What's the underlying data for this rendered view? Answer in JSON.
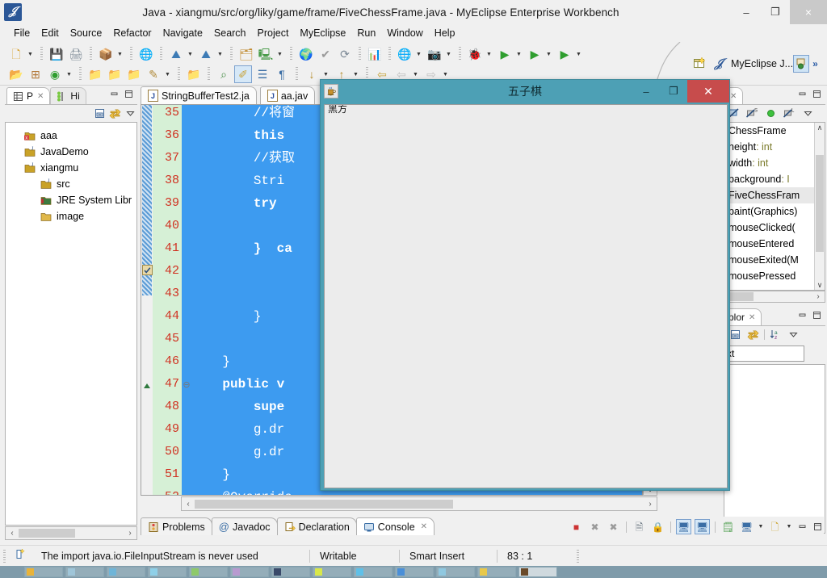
{
  "window": {
    "title": "Java - xiangmu/src/org/liky/game/frame/FiveChessFrame.java - MyEclipse Enterprise Workbench",
    "app_icon": "myeclipse-icon",
    "minimize": "–",
    "maximize": "❐",
    "close": "×"
  },
  "menubar": {
    "items": [
      {
        "label": "File"
      },
      {
        "label": "Edit"
      },
      {
        "label": "Source"
      },
      {
        "label": "Refactor"
      },
      {
        "label": "Navigate"
      },
      {
        "label": "Search"
      },
      {
        "label": "Project"
      },
      {
        "label": "MyEclipse"
      },
      {
        "label": "Run"
      },
      {
        "label": "Window"
      },
      {
        "label": "Help"
      }
    ]
  },
  "toolbar": {
    "row1": [
      {
        "name": "new-wizard-icon",
        "glyph": "🗋",
        "color": "#d7a12c",
        "arrow": true
      },
      {
        "name": "save-icon",
        "glyph": "💾",
        "color": "#9aa4ad",
        "arrow": false
      },
      {
        "name": "print-icon",
        "glyph": "🖨",
        "color": "#7d8a96",
        "arrow": false
      },
      {
        "name": "new-java-package-icon",
        "glyph": "📦",
        "color": "#b0782e",
        "arrow": true
      },
      {
        "name": "open-web-browser-icon",
        "glyph": "🌐",
        "color": "#3a7fc1",
        "arrow": false
      },
      {
        "name": "deploy-icon",
        "glyph": "⛰",
        "color": "#3d7bb5",
        "arrow": true
      },
      {
        "name": "undeploy-icon",
        "glyph": "⛰",
        "color": "#3d7bb5",
        "arrow": true
      },
      {
        "name": "export-icon",
        "glyph": "🗂",
        "color": "#c08a2e",
        "arrow": false
      },
      {
        "name": "run-server-icon",
        "glyph": "🖳",
        "color": "#4a9c4a",
        "arrow": true
      },
      {
        "name": "open-browser-icon",
        "glyph": "🌍",
        "color": "#3a7fc1",
        "arrow": false
      },
      {
        "name": "validate-icon",
        "glyph": "✔",
        "color": "#9a9a9a",
        "arrow": false
      },
      {
        "name": "refresh-icon",
        "glyph": "⟳",
        "color": "#7d8a96",
        "arrow": false
      },
      {
        "name": "report-icon",
        "glyph": "📊",
        "color": "#c9a227",
        "arrow": false
      },
      {
        "name": "web-resource-icon",
        "glyph": "🌐",
        "color": "#3a7fc1",
        "arrow": true
      },
      {
        "name": "snapshot-icon",
        "glyph": "📷",
        "color": "#6e7a85",
        "arrow": true
      },
      {
        "name": "debug-icon",
        "glyph": "🐞",
        "color": "#6b7f33",
        "arrow": true
      },
      {
        "name": "run-icon",
        "glyph": "▶",
        "color": "#2f9e2f",
        "arrow": true
      },
      {
        "name": "run-history-icon",
        "glyph": "▶",
        "color": "#2f9e2f",
        "arrow": true
      },
      {
        "name": "external-tools-icon",
        "glyph": "▶",
        "color": "#2f9e2f",
        "arrow": true
      }
    ],
    "row2": [
      {
        "name": "open-type-icon",
        "glyph": "📂",
        "color": "#c79a35",
        "arrow": false
      },
      {
        "name": "new-class-icon",
        "glyph": "⊞",
        "color": "#b4793a",
        "arrow": false
      },
      {
        "name": "myeclipse-config-icon",
        "glyph": "◉",
        "color": "#2f9e2f",
        "arrow": true
      },
      {
        "name": "open-package-red-icon",
        "glyph": "📁",
        "color": "#c79a35",
        "arrow": false
      },
      {
        "name": "open-package-purple-icon",
        "glyph": "📁",
        "color": "#c79a35",
        "arrow": false
      },
      {
        "name": "open-package-blue-icon",
        "glyph": "📁",
        "color": "#c79a35",
        "arrow": false
      },
      {
        "name": "edit-icon",
        "glyph": "✎",
        "color": "#b08a3a",
        "arrow": true
      },
      {
        "name": "open-resource-icon",
        "glyph": "📁",
        "color": "#c79a35",
        "arrow": false
      },
      {
        "name": "search-type-icon",
        "glyph": "⌕",
        "color": "#4a8f4a",
        "arrow": false
      },
      {
        "name": "toggle-markoccurrences-icon",
        "glyph": "✐",
        "color": "#c8a33a",
        "arrow": false,
        "selected": true
      },
      {
        "name": "show-whitespace-icon",
        "glyph": "☰",
        "color": "#3b6ea5",
        "arrow": false
      },
      {
        "name": "show-pilcrow-icon",
        "glyph": "¶",
        "color": "#3b6ea5",
        "arrow": false
      },
      {
        "name": "next-annotation-icon",
        "glyph": "↓",
        "color": "#b58b2a",
        "arrow": true
      },
      {
        "name": "previous-annotation-icon",
        "glyph": "↑",
        "color": "#b58b2a",
        "arrow": true
      },
      {
        "name": "last-edit-location-icon",
        "glyph": "⇦",
        "color": "#c7a33a",
        "arrow": false
      },
      {
        "name": "back-icon",
        "glyph": "⇦",
        "color": "#c0c0c0",
        "arrow": true
      },
      {
        "name": "forward-icon",
        "glyph": "⇨",
        "color": "#c0c0c0",
        "arrow": true
      }
    ],
    "perspective": {
      "open_perspective_icon": "open-perspective-icon",
      "myeclipse_icon": "myeclipse-java-icon",
      "label": "MyEclipse J...",
      "selected_icon": "java-perspective-icon",
      "chevron": "»"
    }
  },
  "package_explorer": {
    "tabs": [
      {
        "name": "tab-package-explorer",
        "label": "P",
        "icon": "package-explorer-icon",
        "active": true,
        "close": "✕"
      },
      {
        "name": "tab-hierarchy",
        "label": "Hi",
        "icon": "hierarchy-icon",
        "active": false
      }
    ],
    "toolbar": [
      {
        "name": "collapse-all-icon",
        "glyph": "⊟"
      },
      {
        "name": "link-with-editor-icon",
        "glyph": "⇆"
      },
      {
        "name": "view-menu-icon",
        "glyph": "▽"
      }
    ],
    "window_controls": [
      {
        "name": "minimize-view-icon",
        "glyph": "—"
      },
      {
        "name": "maximize-view-icon",
        "glyph": "❐"
      }
    ],
    "tree": [
      {
        "label": "aaa",
        "icon": "java-project-error-icon",
        "level": 1
      },
      {
        "label": "JavaDemo",
        "icon": "java-project-icon",
        "level": 1
      },
      {
        "label": "xiangmu",
        "icon": "java-project-icon",
        "level": 1
      },
      {
        "label": "src",
        "icon": "source-folder-icon",
        "level": 2
      },
      {
        "label": "JRE System Libr",
        "icon": "jre-library-icon",
        "level": 2
      },
      {
        "label": "image",
        "icon": "folder-icon",
        "level": 2
      }
    ],
    "hscroll": {
      "left_arrow": "‹",
      "right_arrow": "›"
    }
  },
  "editor": {
    "tabs": [
      {
        "name": "editor-tab-stringbuffertest2",
        "label": "StringBufferTest2.ja",
        "icon": "java-file-icon",
        "letter": "J"
      },
      {
        "name": "editor-tab-aa",
        "label": "aa.jav",
        "icon": "java-file-icon",
        "letter": "J"
      }
    ],
    "lines": [
      {
        "num": "35",
        "text": "        //将窗",
        "fold": "",
        "marker": false
      },
      {
        "num": "36",
        "text": "        this",
        "fold": "",
        "marker": false,
        "bold": true
      },
      {
        "num": "37",
        "text": "        //获取",
        "fold": "",
        "marker": false
      },
      {
        "num": "38",
        "text": "        Stri",
        "fold": "",
        "marker": false
      },
      {
        "num": "39",
        "text": "        try",
        "fold": "",
        "marker": false,
        "bold": true
      },
      {
        "num": "40",
        "text": "",
        "fold": "",
        "marker": false
      },
      {
        "num": "41",
        "text": "        }  ca",
        "fold": "",
        "marker": false,
        "bold": true
      },
      {
        "num": "42",
        "text": "",
        "fold": "",
        "marker": true
      },
      {
        "num": "43",
        "text": "",
        "fold": "",
        "marker": false
      },
      {
        "num": "44",
        "text": "        }",
        "fold": "",
        "marker": false
      },
      {
        "num": "45",
        "text": "",
        "fold": "",
        "marker": false
      },
      {
        "num": "46",
        "text": "    }",
        "fold": "",
        "marker": false
      },
      {
        "num": "47",
        "text": "    public v",
        "fold": "⊖",
        "marker": false,
        "bold": true
      },
      {
        "num": "48",
        "text": "        supe",
        "fold": "",
        "marker": false,
        "bold": true
      },
      {
        "num": "49",
        "text": "        g.dr",
        "fold": "",
        "marker": false
      },
      {
        "num": "50",
        "text": "        g.dr",
        "fold": "",
        "marker": false
      },
      {
        "num": "51",
        "text": "    }",
        "fold": "",
        "marker": false
      },
      {
        "num": "52",
        "text": "    @Override",
        "fold": "⊖",
        "marker": false
      }
    ],
    "hscroll": {
      "left_arrow": "‹",
      "right_arrow": "›"
    },
    "vscroll": {
      "up_arrow": "∧",
      "down_arrow": "∨"
    }
  },
  "outline": {
    "tab": {
      "name": "tab-outline",
      "label": "",
      "close": "✕"
    },
    "window_controls": [
      {
        "name": "minimize-view-icon",
        "glyph": "—"
      },
      {
        "name": "maximize-view-icon",
        "glyph": "❐"
      }
    ],
    "toolbar": [
      {
        "name": "hide-fields-icon",
        "glyph": "◨"
      },
      {
        "name": "hide-static-icon",
        "glyph": "S"
      },
      {
        "name": "hide-nonpublic-icon",
        "glyph": "●"
      },
      {
        "name": "hide-local-types-icon",
        "glyph": "L"
      },
      {
        "name": "view-menu-icon",
        "glyph": "▽"
      }
    ],
    "rows": [
      {
        "label": "ChessFrame",
        "icon": "class-icon",
        "selected": false
      },
      {
        "label": "height",
        "type": "int",
        "icon": "field-icon",
        "selected": false
      },
      {
        "label": "width",
        "type": "int",
        "icon": "field-icon",
        "selected": false
      },
      {
        "label": "background",
        "type": "I",
        "icon": "field-icon",
        "selected": false
      },
      {
        "label": "FiveChessFram",
        "type": "",
        "icon": "constructor-icon",
        "selected": true
      },
      {
        "label": "paint(Graphics)",
        "type": "",
        "icon": "method-icon",
        "selected": false
      },
      {
        "label": "mouseClicked(",
        "type": "",
        "icon": "method-icon",
        "selected": false
      },
      {
        "label": "mouseEntered",
        "type": "",
        "icon": "method-icon",
        "selected": false
      },
      {
        "label": "mouseExited(M",
        "type": "",
        "icon": "method-icon",
        "selected": false
      },
      {
        "label": "mousePressed",
        "type": "",
        "icon": "method-icon",
        "selected": false
      }
    ],
    "scroll": {
      "up_arrow": "∧",
      "down_arrow": "∨",
      "right_arrow": "›"
    }
  },
  "explorer_panel": {
    "tab_label": "plor",
    "tab_close": "✕",
    "window_controls": [
      {
        "name": "minimize-view-icon",
        "glyph": "—"
      },
      {
        "name": "maximize-view-icon",
        "glyph": "❐"
      }
    ],
    "toolbar": [
      {
        "name": "collapse-all-icon",
        "glyph": "⊟"
      },
      {
        "name": "link-with-editor-icon",
        "glyph": "⇆"
      },
      {
        "name": "sort-az-icon",
        "glyph": "↓"
      },
      {
        "name": "view-menu-icon",
        "glyph": "▽"
      }
    ],
    "search_value": "xt"
  },
  "bottom_view": {
    "tabs": [
      {
        "name": "tab-problems",
        "label": "Problems",
        "icon": "problems-icon",
        "active": false
      },
      {
        "name": "tab-javadoc",
        "label": "Javadoc",
        "icon": "javadoc-icon",
        "active": false
      },
      {
        "name": "tab-declaration",
        "label": "Declaration",
        "icon": "declaration-icon",
        "active": false
      },
      {
        "name": "tab-console",
        "label": "Console",
        "icon": "console-icon",
        "active": true,
        "close": "✕"
      }
    ],
    "toolbar": [
      {
        "name": "terminate-icon",
        "glyph": "■",
        "color": "#cc3333"
      },
      {
        "name": "remove-launch-icon",
        "glyph": "✖",
        "color": "#9a9a9a"
      },
      {
        "name": "remove-all-terminated-icon",
        "glyph": "✖",
        "color": "#9a9a9a"
      },
      {
        "name": "clear-console-icon",
        "glyph": "🗎",
        "color": "#6e7a85"
      },
      {
        "name": "scroll-lock-icon",
        "glyph": "🔒",
        "color": "#c9a227"
      },
      {
        "name": "pin-console-icon",
        "glyph": "🖥",
        "color": "#3b6ea5",
        "selected": true
      },
      {
        "name": "display-selected-console-icon",
        "glyph": "🖥",
        "color": "#3b6ea5",
        "selected": true
      },
      {
        "name": "open-console-icon",
        "glyph": "🗒",
        "color": "#4a9c4a"
      },
      {
        "name": "new-console-view-icon",
        "glyph": "🖥",
        "color": "#3b6ea5",
        "arrow": true
      },
      {
        "name": "console-options-icon",
        "glyph": "🗋",
        "color": "#c9a227",
        "arrow": true
      }
    ],
    "window_controls": [
      {
        "name": "minimize-view-icon",
        "glyph": "—"
      },
      {
        "name": "maximize-view-icon",
        "glyph": "❐"
      }
    ]
  },
  "statusbar": {
    "icon": "smart-insert-icon",
    "message": "The import java.io.FileInputStream is never used",
    "writable": "Writable",
    "insert_mode": "Smart Insert",
    "position": "83 : 1"
  },
  "child_window": {
    "title": "五子棋",
    "icon": "java-coffee-icon",
    "minimize": "–",
    "maximize": "❐",
    "close": "✕",
    "client_label": "黑方",
    "frame_color": "#4da0b5",
    "close_color": "#c74c4c",
    "client_color": "#ececec"
  },
  "taskbar": {
    "items": [
      {
        "name": "taskbar-item-1",
        "active": false
      },
      {
        "name": "taskbar-item-2",
        "active": false
      },
      {
        "name": "taskbar-item-3",
        "active": false
      },
      {
        "name": "taskbar-item-4",
        "active": false
      },
      {
        "name": "taskbar-item-5",
        "active": false
      },
      {
        "name": "taskbar-item-6",
        "active": false
      },
      {
        "name": "taskbar-item-7",
        "active": false
      },
      {
        "name": "taskbar-item-8",
        "active": false
      },
      {
        "name": "taskbar-item-9",
        "active": false
      },
      {
        "name": "taskbar-item-10",
        "active": false
      },
      {
        "name": "taskbar-item-11",
        "active": false
      },
      {
        "name": "taskbar-item-12",
        "active": false
      },
      {
        "name": "taskbar-item-13",
        "active": true
      }
    ]
  }
}
